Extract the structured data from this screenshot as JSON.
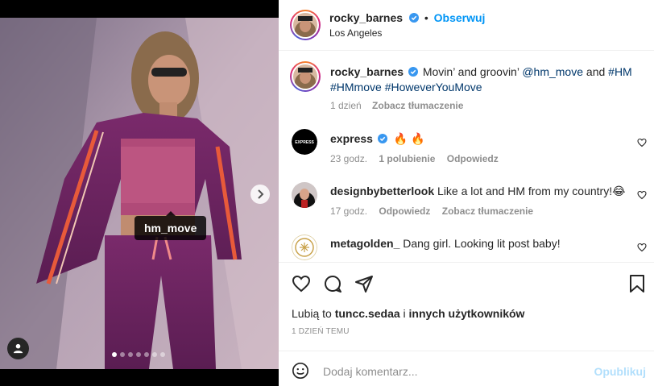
{
  "post": {
    "author": "rocky_barnes",
    "follow_label": "Obserwuj",
    "location": "Los Angeles",
    "tag_label": "hm_move",
    "carousel_dots": 7,
    "active_dot": 0
  },
  "caption": {
    "author": "rocky_barnes",
    "text_before": "Movin’ and groovin’ ",
    "mention": "@hm_move",
    "text_mid": " and ",
    "hashtag1": "#HM",
    "hashtag2": "#HMmove",
    "hashtag3": "#HoweverYouMove",
    "age": "1 dzień",
    "translate": "Zobacz tłumaczenie"
  },
  "comments": [
    {
      "user": "express",
      "text": "🔥 🔥",
      "age": "23 godz.",
      "likes": "1 polubienie",
      "reply": "Odpowiedz"
    },
    {
      "user": "designbybetterlook",
      "text": "Like a lot and HM from my country!😂",
      "age": "17 godz.",
      "reply": "Odpowiedz",
      "translate": "Zobacz tłumaczenie"
    },
    {
      "user": "metagolden_",
      "text": "Dang girl. Looking lit post baby!"
    }
  ],
  "likes": {
    "prefix": "Lubią to ",
    "user": "tuncc.sedaa",
    "mid": " i ",
    "others": "innych użytkowników"
  },
  "timestamp": "1 DZIEŃ TEMU",
  "composer": {
    "placeholder": "Dodaj komentarz...",
    "publish": "Opublikuj"
  },
  "icons": [
    "chevron-right-icon",
    "user-tag-icon",
    "verified-icon",
    "heart-icon",
    "comment-icon",
    "share-icon",
    "bookmark-icon",
    "emoji-icon"
  ],
  "colors": {
    "accent": "#0095f6",
    "verified": "#3897f0",
    "link": "#00376b",
    "muted": "#8e8e8e"
  }
}
